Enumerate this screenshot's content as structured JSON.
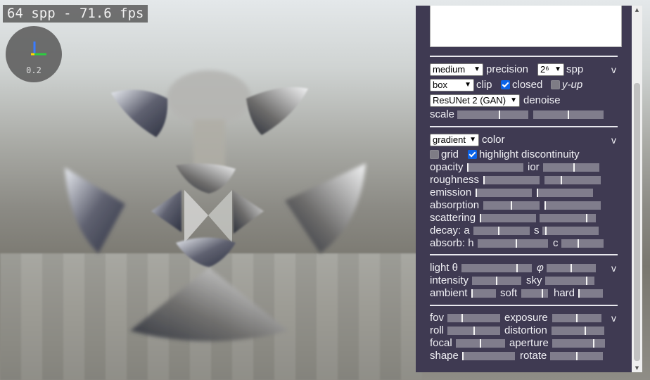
{
  "hud": {
    "spp_fps": "64 spp - 71.6 fps"
  },
  "gizmo": {
    "zoom": "0.2",
    "axis_colors": {
      "x": "#2ecc40",
      "y": "#ffd700",
      "z": "#3a7bff"
    }
  },
  "panel": {
    "notes_text": "",
    "render": {
      "precision_select": "medium",
      "precision_label": "precision",
      "spp_select": "2⁶",
      "spp_label": "spp",
      "clip_select": "box",
      "clip_label": "clip",
      "closed_label": "closed",
      "closed_checked": true,
      "yup_label": "y-up",
      "yup_checked": false,
      "denoise_select": "ResUNet 2 (GAN)",
      "denoise_label": "denoise",
      "scale_label": "scale",
      "scale_a": 0.6,
      "scale_b": 0.5,
      "collapse": "v"
    },
    "material": {
      "color_select": "gradient",
      "color_label": "color",
      "grid_label": "grid",
      "grid_checked": false,
      "highlight_label": "highlight discontinuity",
      "highlight_checked": true,
      "opacity_label": "opacity",
      "opacity": 0.0,
      "ior_label": "ior",
      "ior": 0.55,
      "roughness_label": "roughness",
      "roughness": 0.0,
      "roughness_b": 0.3,
      "emission_label": "emission",
      "emission": 0.0,
      "emission_b": 0.0,
      "absorption_label": "absorption",
      "absorption": 0.5,
      "absorption_b": 0.0,
      "scattering_label": "scattering",
      "scattering": 0.0,
      "scattering_b": 0.85,
      "decay_label": "decay: a",
      "decay_a": 0.45,
      "s_label": "s",
      "decay_s": 0.05,
      "absorb_label": "absorb: h",
      "absorb_h": 0.55,
      "c_label": "c",
      "absorb_c": 0.4,
      "collapse": "v"
    },
    "light": {
      "light_label": "light θ",
      "theta": 0.8,
      "phi_label": "φ",
      "phi": 0.5,
      "intensity_label": "intensity",
      "intensity": 0.5,
      "sky_label": "sky",
      "sky": 0.85,
      "ambient_label": "ambient",
      "ambient": 0.0,
      "soft_label": "soft",
      "soft": 0.8,
      "hard_label": "hard",
      "hard": 0.0,
      "collapse": "v"
    },
    "camera": {
      "fov_label": "fov",
      "fov": 0.28,
      "exposure_label": "exposure",
      "exposure": 0.5,
      "roll_label": "roll",
      "roll": 0.5,
      "distortion_label": "distortion",
      "distortion": 0.65,
      "focal_label": "focal",
      "focal": 0.5,
      "aperture_label": "aperture",
      "aperture": 0.8,
      "shape_label": "shape",
      "shape": 0.0,
      "rotate_label": "rotate",
      "rotate": 0.5,
      "collapse": "v"
    }
  }
}
